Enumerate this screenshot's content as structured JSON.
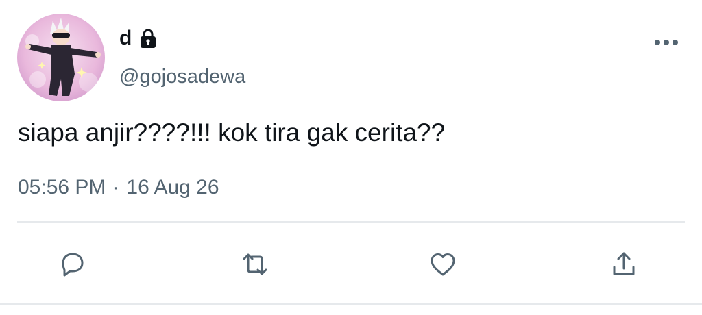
{
  "tweet": {
    "author": {
      "display_name": "d",
      "handle": "@gojosadewa",
      "protected_icon": "lock-icon",
      "avatar": "avatar-image"
    },
    "more_icon": "more-horizontal-icon",
    "text": "siapa anjir????!!! kok tira gak cerita??",
    "time": "05:56 PM",
    "separator": "·",
    "date": "16 Aug 26"
  },
  "actions": [
    {
      "name": "reply",
      "icon": "reply-icon"
    },
    {
      "name": "retweet",
      "icon": "retweet-icon"
    },
    {
      "name": "like",
      "icon": "heart-icon"
    },
    {
      "name": "share",
      "icon": "share-icon"
    }
  ],
  "colors": {
    "text_primary": "#0f1419",
    "text_secondary": "#536471",
    "divider": "#e6e9ec",
    "icon": "#536471"
  }
}
